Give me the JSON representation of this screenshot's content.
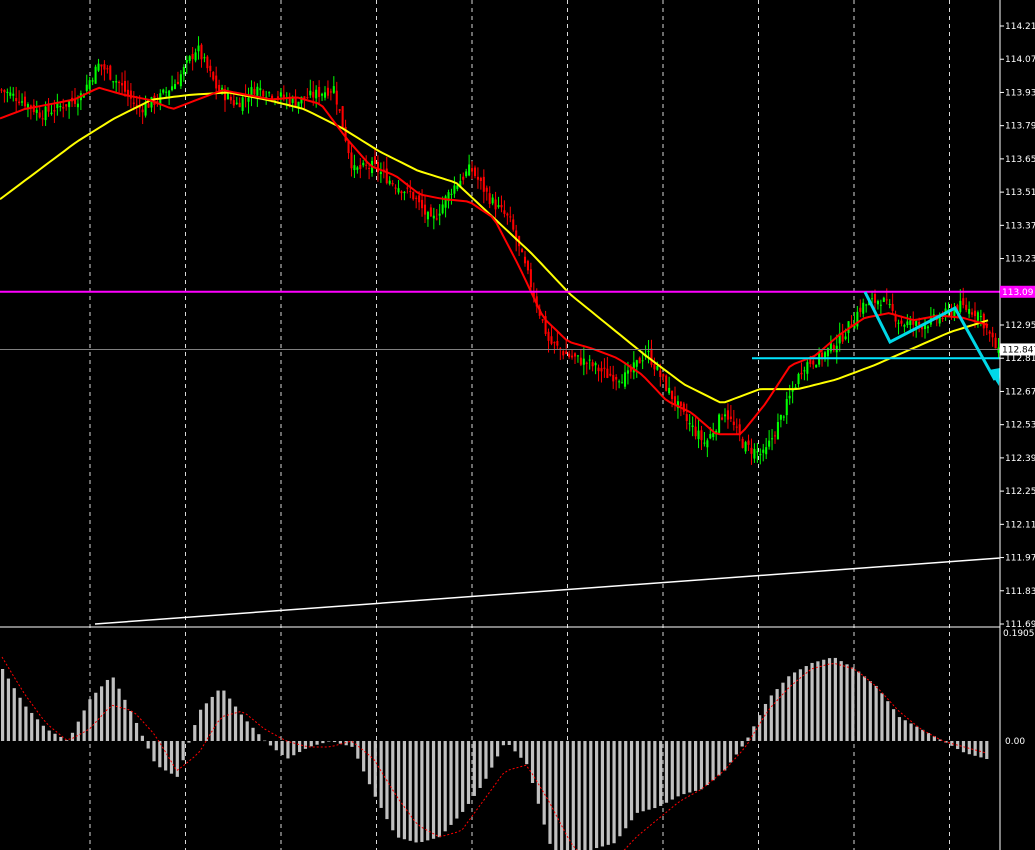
{
  "chart_data": [
    {
      "type": "candlestick",
      "panel": "main",
      "ylim": [
        11.69,
        114.21
      ],
      "y_axis_ticks": [
        "114.210",
        "114.070",
        "113.930",
        "113.790",
        "113.650",
        "113.510",
        "113.370",
        "113.230",
        "113.090",
        "112.950",
        "112.810",
        "112.670",
        "112.530",
        "112.390",
        "112.250",
        "112.110",
        "111.970",
        "111.830",
        "111.690"
      ],
      "tick_values": [
        114.21,
        114.07,
        113.93,
        113.79,
        113.65,
        113.51,
        113.37,
        113.23,
        113.09,
        112.95,
        112.81,
        112.67,
        112.53,
        112.39,
        112.25,
        112.11,
        111.97,
        111.83,
        111.69
      ],
      "close_anchors": [
        113.94,
        113.9,
        113.84,
        113.87,
        113.91,
        114.05,
        113.97,
        113.86,
        113.9,
        113.98,
        114.12,
        113.95,
        113.88,
        113.95,
        113.92,
        113.89,
        113.92,
        113.95,
        113.6,
        113.62,
        113.55,
        113.5,
        113.38,
        113.52,
        113.61,
        113.48,
        113.39,
        113.14,
        112.88,
        112.82,
        112.79,
        112.74,
        112.73,
        112.84,
        112.69,
        112.55,
        112.45,
        112.59,
        112.44,
        112.4,
        112.58,
        112.78,
        112.82,
        112.9,
        113.03,
        113.06,
        112.96,
        112.95,
        112.98,
        113.03,
        113.0,
        112.83
      ],
      "ma_fast": [
        113.82,
        113.86,
        113.88,
        113.9,
        113.95,
        113.92,
        113.9,
        113.86,
        113.9,
        113.94,
        113.92,
        113.9,
        113.91,
        113.88,
        113.74,
        113.62,
        113.58,
        113.5,
        113.48,
        113.47,
        113.4,
        113.2,
        112.98,
        112.88,
        112.85,
        112.81,
        112.74,
        112.63,
        112.58,
        112.49,
        112.49,
        112.62,
        112.78,
        112.82,
        112.91,
        112.98,
        113.0,
        112.97,
        112.99,
        112.98,
        112.95
      ],
      "ma_slow": [
        113.48,
        113.6,
        113.72,
        113.82,
        113.9,
        113.92,
        113.93,
        113.9,
        113.86,
        113.78,
        113.68,
        113.6,
        113.55,
        113.4,
        113.25,
        113.08,
        112.95,
        112.82,
        112.7,
        112.62,
        112.68,
        112.68,
        112.72,
        112.78,
        112.85,
        112.92,
        112.97
      ],
      "horizontal_lines": [
        {
          "value": 113.09,
          "label": "113.09",
          "color": "#ff00ff"
        },
        {
          "value": 112.847,
          "label": "112.847",
          "color": "#808080"
        },
        {
          "value": 112.81,
          "color": "#00e5ff"
        }
      ],
      "trendline": {
        "from": 111.69,
        "to": 111.96,
        "color": "#ffffff"
      },
      "annotations": [
        "cyan zigzag arrow pointing down"
      ],
      "colors": {
        "bull": "#00ff00",
        "bear": "#ff0000",
        "ma_fast": "#ff0000",
        "ma_slow": "#ffff00",
        "grid": "#ffffff"
      }
    },
    {
      "type": "bar",
      "panel": "oscillator",
      "y_axis_ticks": [
        "0.1905",
        "0.00"
      ],
      "histogram_anchors": [
        0.12,
        0.06,
        0.02,
        0.0,
        0.07,
        0.11,
        0.04,
        -0.04,
        -0.06,
        0.05,
        0.09,
        0.04,
        0.0,
        -0.03,
        -0.01,
        0.0,
        -0.01,
        -0.09,
        -0.16,
        -0.17,
        -0.16,
        -0.12,
        -0.07,
        0.0,
        -0.04,
        -0.17,
        -0.22,
        -0.18,
        -0.17,
        -0.12,
        -0.11,
        -0.09,
        -0.08,
        -0.05,
        0.0,
        0.07,
        0.11,
        0.13,
        0.14,
        0.12,
        0.09,
        0.04,
        0.02,
        0.0,
        -0.02,
        -0.03
      ],
      "signal_anchors": [
        0.14,
        0.08,
        0.03,
        0.0,
        0.02,
        0.06,
        0.05,
        0.01,
        -0.05,
        -0.02,
        0.04,
        0.05,
        0.02,
        0.0,
        -0.01,
        -0.01,
        0.0,
        -0.03,
        -0.09,
        -0.14,
        -0.16,
        -0.15,
        -0.1,
        -0.05,
        -0.04,
        -0.1,
        -0.17,
        -0.21,
        -0.2,
        -0.16,
        -0.13,
        -0.1,
        -0.08,
        -0.05,
        -0.01,
        0.05,
        0.09,
        0.12,
        0.13,
        0.12,
        0.09,
        0.05,
        0.02,
        0.0,
        -0.01,
        -0.02
      ],
      "colors": {
        "hist": "#c0c0c0",
        "signal": "#ff0000"
      }
    }
  ]
}
